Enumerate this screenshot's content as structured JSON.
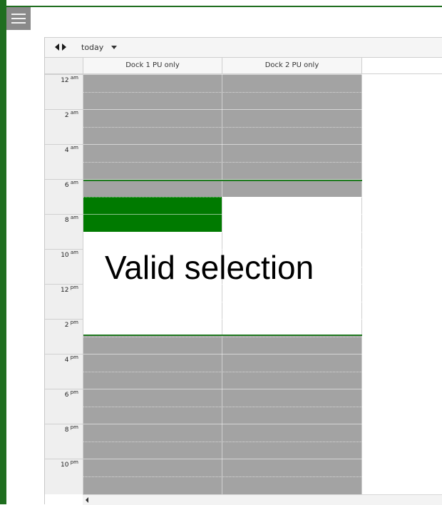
{
  "toolbar": {
    "prev_icon": "triangle-left-icon",
    "next_icon": "triangle-right-icon",
    "today_label": "today",
    "view_caret_icon": "caret-down-icon"
  },
  "menu": {
    "icon": "hamburger-menu-icon"
  },
  "resources": [
    {
      "label": "Dock 1 PU only"
    },
    {
      "label": "Dock 2 PU only"
    }
  ],
  "time_labels": [
    {
      "hour": "12",
      "suffix": "am"
    },
    {
      "hour": "2",
      "suffix": "am"
    },
    {
      "hour": "4",
      "suffix": "am"
    },
    {
      "hour": "6",
      "suffix": "am"
    },
    {
      "hour": "8",
      "suffix": "am"
    },
    {
      "hour": "10",
      "suffix": "am"
    },
    {
      "hour": "12",
      "suffix": "pm"
    },
    {
      "hour": "2",
      "suffix": "pm"
    },
    {
      "hour": "4",
      "suffix": "pm"
    },
    {
      "hour": "6",
      "suffix": "pm"
    },
    {
      "hour": "8",
      "suffix": "pm"
    },
    {
      "hour": "10",
      "suffix": "pm"
    }
  ],
  "selection_message": "Valid selection",
  "colors": {
    "unavailable": "#a3a3a3",
    "selection": "#007a00",
    "frame": "#1f6e1f"
  }
}
